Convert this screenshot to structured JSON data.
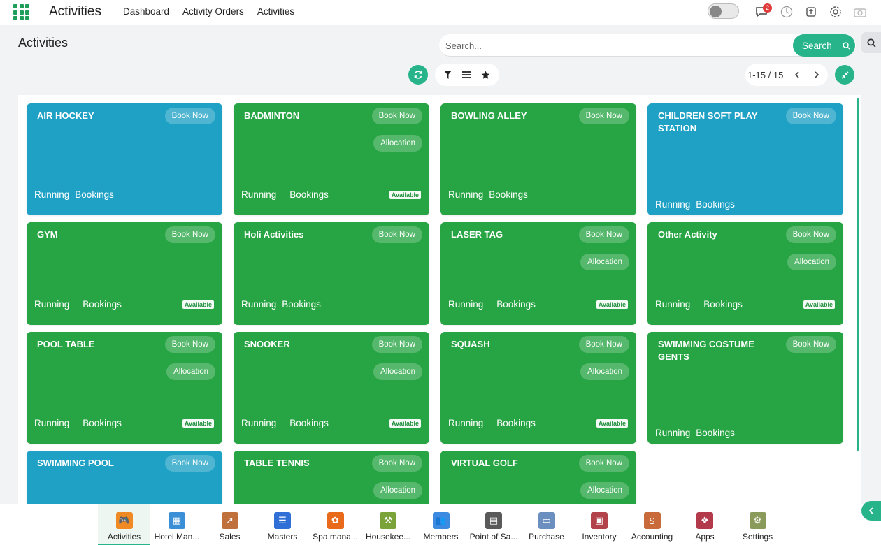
{
  "header": {
    "app_title": "Activities",
    "nav": [
      "Dashboard",
      "Activity Orders",
      "Activities"
    ],
    "notification_count": "2"
  },
  "page": {
    "title": "Activities",
    "search_placeholder": "Search...",
    "search_button": "Search",
    "pager": "1-15 / 15"
  },
  "colors": {
    "accent": "#27b48a",
    "card_green": "#27a443",
    "card_blue": "#1ea1c4"
  },
  "labels": {
    "book_now": "Book Now",
    "allocation": "Allocation",
    "running": "Running",
    "bookings": "Bookings",
    "available": "Available"
  },
  "cards": [
    {
      "name": "AIR HOCKEY",
      "color": "blue",
      "allocation": false,
      "available": false
    },
    {
      "name": "BADMINTON",
      "color": "green",
      "allocation": true,
      "available": true
    },
    {
      "name": "BOWLING ALLEY",
      "color": "green",
      "allocation": false,
      "available": false
    },
    {
      "name": "CHILDREN SOFT PLAY STATION",
      "color": "blue",
      "allocation": false,
      "available": false
    },
    {
      "name": "GYM",
      "color": "green",
      "allocation": false,
      "available": true
    },
    {
      "name": "Holi Activities",
      "color": "green",
      "allocation": false,
      "available": false
    },
    {
      "name": "LASER TAG",
      "color": "green",
      "allocation": true,
      "available": true
    },
    {
      "name": "Other Activity",
      "color": "green",
      "allocation": true,
      "available": true
    },
    {
      "name": "POOL TABLE",
      "color": "green",
      "allocation": true,
      "available": true
    },
    {
      "name": "SNOOKER",
      "color": "green",
      "allocation": true,
      "available": true
    },
    {
      "name": "SQUASH",
      "color": "green",
      "allocation": true,
      "available": true
    },
    {
      "name": "SWIMMING COSTUME GENTS",
      "color": "green",
      "allocation": false,
      "available": false
    },
    {
      "name": "SWIMMING POOL",
      "color": "blue",
      "allocation": false,
      "available": false
    },
    {
      "name": "TABLE TENNIS",
      "color": "green",
      "allocation": true,
      "available": false
    },
    {
      "name": "VIRTUAL GOLF",
      "color": "green",
      "allocation": true,
      "available": false
    }
  ],
  "dock": [
    {
      "label": "Activities",
      "icon": "gamepad-icon",
      "color": "#f08a24",
      "glyph": "🎮",
      "active": true
    },
    {
      "label": "Hotel Man...",
      "icon": "hotel-icon",
      "color": "#3a8fd6",
      "glyph": "▦"
    },
    {
      "label": "Sales",
      "icon": "sales-chart-icon",
      "color": "#c0703a",
      "glyph": "↗"
    },
    {
      "label": "Masters",
      "icon": "list-icon",
      "color": "#2f6fd6",
      "glyph": "☰"
    },
    {
      "label": "Spa mana...",
      "icon": "spa-icon",
      "color": "#e86a1a",
      "glyph": "✿"
    },
    {
      "label": "Housekee...",
      "icon": "broom-icon",
      "color": "#7aa33a",
      "glyph": "⚒"
    },
    {
      "label": "Members",
      "icon": "members-icon",
      "color": "#3d8be0",
      "glyph": "👥"
    },
    {
      "label": "Point of Sa...",
      "icon": "pos-icon",
      "color": "#5a5a5a",
      "glyph": "▤"
    },
    {
      "label": "Purchase",
      "icon": "card-icon",
      "color": "#6b8fbf",
      "glyph": "▭"
    },
    {
      "label": "Inventory",
      "icon": "box-icon",
      "color": "#b3434a",
      "glyph": "▣"
    },
    {
      "label": "Accounting",
      "icon": "accounting-icon",
      "color": "#c86a3a",
      "glyph": "$"
    },
    {
      "label": "Apps",
      "icon": "apps-cube-icon",
      "color": "#b23a4a",
      "glyph": "❖"
    },
    {
      "label": "Settings",
      "icon": "settings-icon",
      "color": "#8a9a5a",
      "glyph": "⚙"
    }
  ]
}
